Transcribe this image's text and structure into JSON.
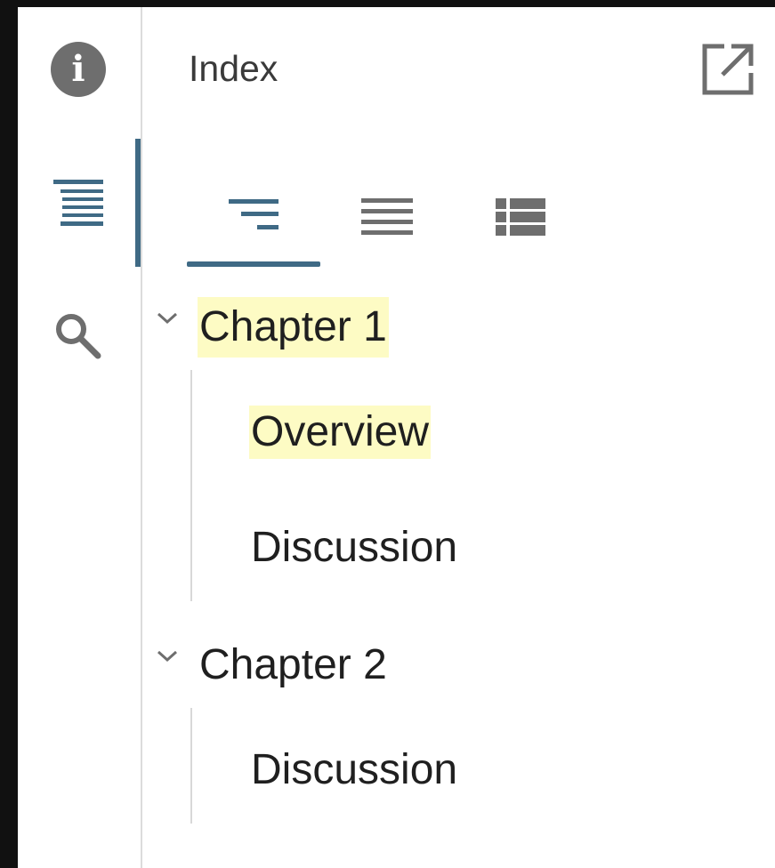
{
  "colors": {
    "accent": "#3f6a85",
    "highlight": "#fdfbc4",
    "icon_gray": "#6e6e6e"
  },
  "rail": {
    "items": [
      {
        "icon": "info-icon",
        "active": false
      },
      {
        "icon": "table-of-contents-icon",
        "active": true
      },
      {
        "icon": "search-icon",
        "active": false
      }
    ]
  },
  "panel": {
    "title": "Index",
    "popout_icon": "open-in-new-window-icon"
  },
  "tabs": [
    {
      "icon": "nested-list-icon",
      "active": true
    },
    {
      "icon": "flat-list-icon",
      "active": false
    },
    {
      "icon": "detailed-list-icon",
      "active": false
    }
  ],
  "toc": {
    "chapters": [
      {
        "label": "Chapter 1",
        "expanded": true,
        "highlighted": true,
        "sections": [
          {
            "label": "Overview",
            "highlighted": true
          },
          {
            "label": "Discussion",
            "highlighted": false
          }
        ]
      },
      {
        "label": "Chapter 2",
        "expanded": true,
        "highlighted": false,
        "sections": [
          {
            "label": "Discussion",
            "highlighted": false
          }
        ]
      }
    ]
  }
}
